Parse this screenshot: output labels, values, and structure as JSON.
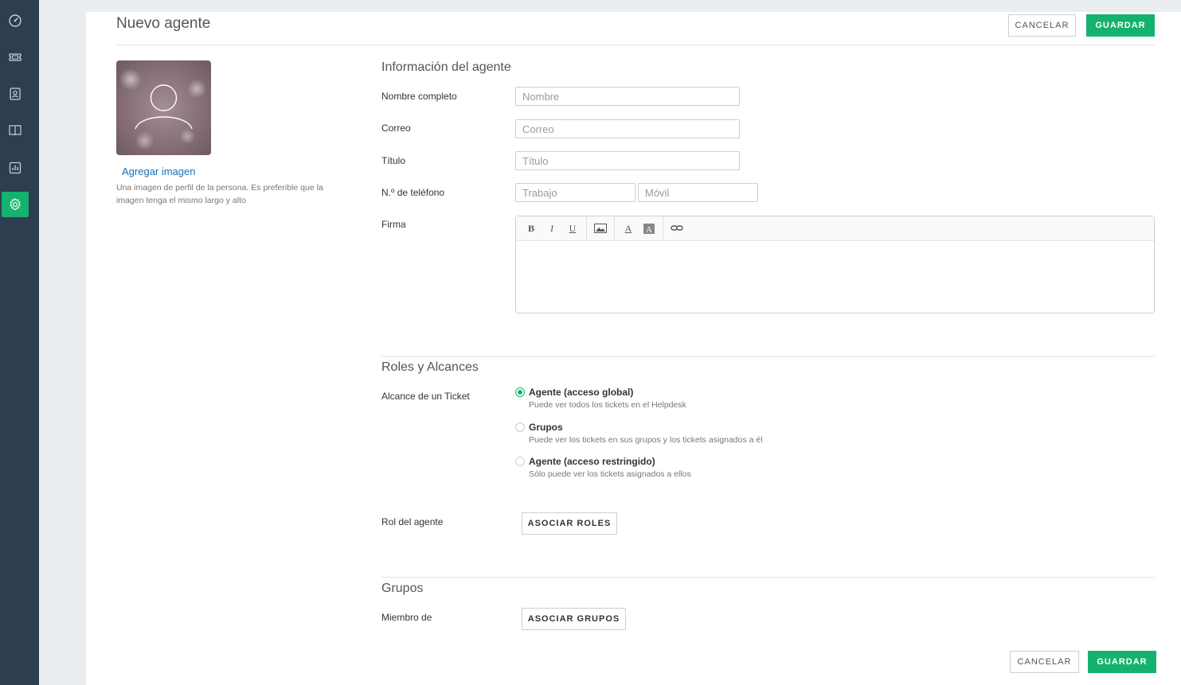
{
  "sidebar": {
    "items": [
      {
        "icon": "dashboard-icon"
      },
      {
        "icon": "ticket-icon"
      },
      {
        "icon": "contacts-icon"
      },
      {
        "icon": "book-icon"
      },
      {
        "icon": "reports-icon"
      },
      {
        "icon": "gear-icon",
        "active": true
      }
    ]
  },
  "header": {
    "title": "Nuevo agente",
    "cancel_label": "CANCELAR",
    "save_label": "GUARDAR"
  },
  "avatar": {
    "add_link": "Agregar imagen",
    "help": "Una imagen de perfil de la persona. Es preferible que la imagen tenga el mismo largo y alto"
  },
  "agent_info": {
    "title": "Información del agente",
    "full_name": {
      "label": "Nombre completo",
      "placeholder": "Nombre",
      "value": ""
    },
    "email": {
      "label": "Correo",
      "placeholder": "Correo",
      "value": ""
    },
    "job_title": {
      "label": "Título",
      "placeholder": "Título",
      "value": ""
    },
    "phone": {
      "label": "N.º de teléfono",
      "work_placeholder": "Trabajo",
      "mobile_placeholder": "Móvil"
    },
    "signature": {
      "label": "Firma"
    }
  },
  "roles": {
    "title": "Roles y Alcances",
    "scope_label": "Alcance de un Ticket",
    "options": [
      {
        "title": "Agente (acceso global)",
        "desc": "Puede ver todos los tickets en el Helpdesk",
        "checked": true
      },
      {
        "title": "Grupos",
        "desc": "Puede ver los tickets en sus grupos y los tickets asignados a él",
        "checked": false
      },
      {
        "title": "Agente (acceso restringido)",
        "desc": "Sólo puede ver los tickets asignados a ellos",
        "checked": false
      }
    ],
    "role_label": "Rol del agente",
    "associate_roles": "ASOCIAR ROLES"
  },
  "groups": {
    "title": "Grupos",
    "member_label": "Miembro de",
    "associate_groups": "ASOCIAR GRUPOS"
  },
  "footer": {
    "cancel_label": "CANCELAR",
    "save_label": "GUARDAR"
  },
  "colors": {
    "accent": "#15b26f",
    "sidebar": "#2c3e4f",
    "link": "#1a6fb5"
  }
}
